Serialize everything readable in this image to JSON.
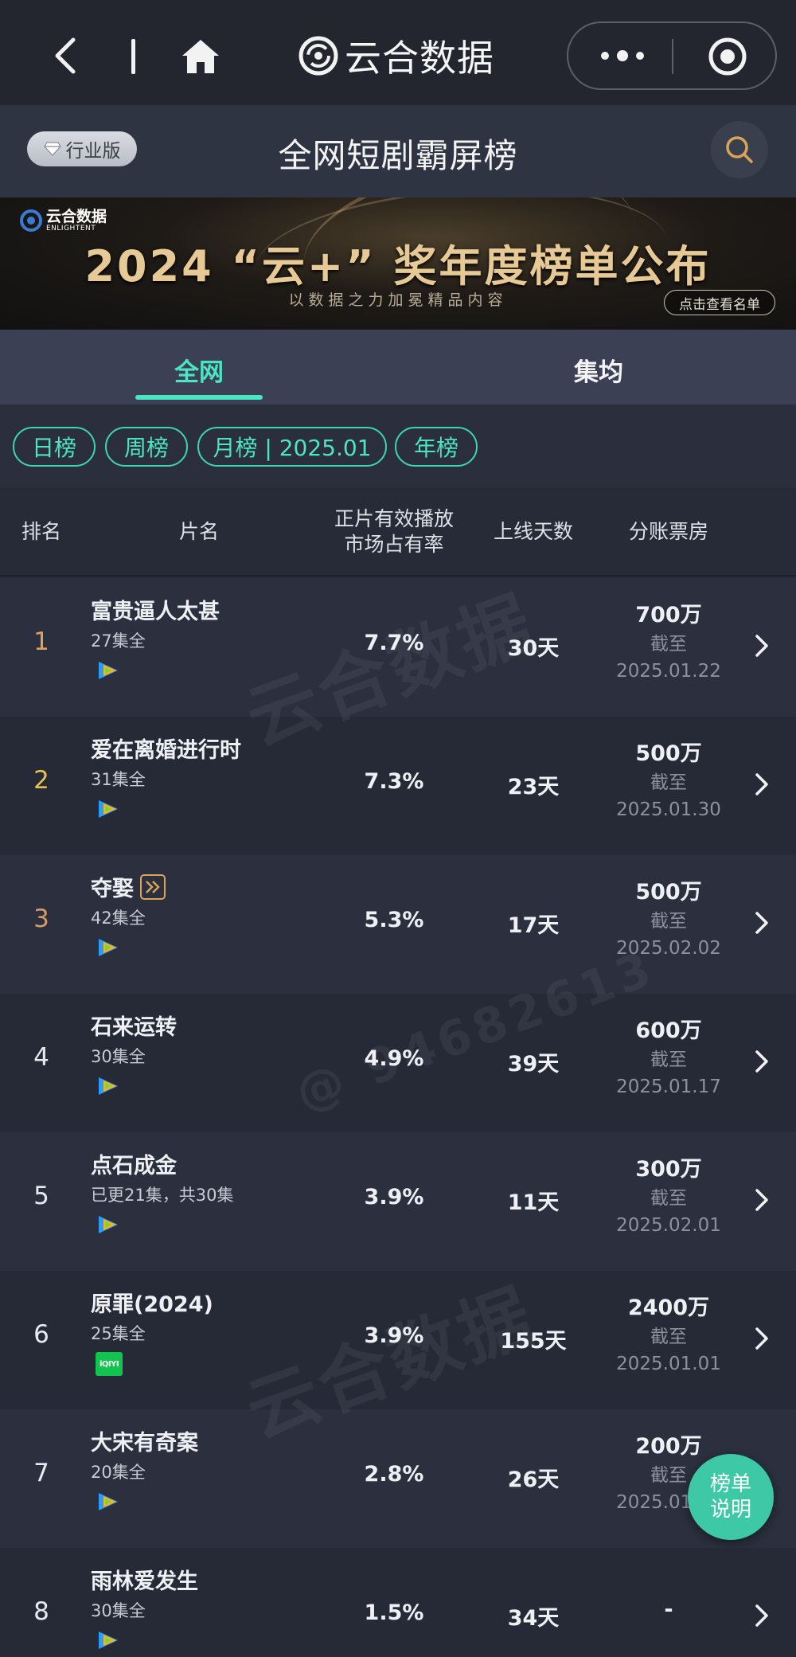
{
  "nav": {
    "brand": "云合数据"
  },
  "header": {
    "badge": "行业版",
    "title": "全网短剧霸屏榜"
  },
  "banner": {
    "logo_cn": "云合数据",
    "logo_en": "ENLIGHTENT",
    "title": "2024 “云+” 奖年度榜单公布",
    "subtitle": "以数据之力加冕精品内容",
    "button": "点击查看名单"
  },
  "tabs": [
    {
      "label": "全网",
      "active": true
    },
    {
      "label": "集均",
      "active": false
    }
  ],
  "periods": [
    {
      "label": "日榜",
      "active": false
    },
    {
      "label": "周榜",
      "active": false
    },
    {
      "label": "月榜 | 2025.01",
      "active": true
    },
    {
      "label": "年榜",
      "active": false
    }
  ],
  "table": {
    "headers": {
      "rank": "排名",
      "name": "片名",
      "share_line1": "正片有效播放",
      "share_line2": "市场占有率",
      "days": "上线天数",
      "box": "分账票房"
    },
    "rows": [
      {
        "rank": "1",
        "name": "富贵逼人太甚",
        "episodes": "27集全",
        "platform": "tencent-video-icon",
        "share": "7.7%",
        "days": "30天",
        "box": "700万",
        "asof_label": "截至",
        "asof_date": "2025.01.22"
      },
      {
        "rank": "2",
        "name": "爱在离婚进行时",
        "episodes": "31集全",
        "platform": "tencent-video-icon",
        "share": "7.3%",
        "days": "23天",
        "box": "500万",
        "asof_label": "截至",
        "asof_date": "2025.01.30"
      },
      {
        "rank": "3",
        "name": "夺娶",
        "episodes": "42集全",
        "platform": "tencent-video-icon",
        "share": "5.3%",
        "days": "17天",
        "box": "500万",
        "asof_label": "截至",
        "asof_date": "2025.02.02"
      },
      {
        "rank": "4",
        "name": "石来运转",
        "episodes": "30集全",
        "platform": "tencent-video-icon",
        "share": "4.9%",
        "days": "39天",
        "box": "600万",
        "asof_label": "截至",
        "asof_date": "2025.01.17"
      },
      {
        "rank": "5",
        "name": "点石成金",
        "episodes": "已更21集，共30集",
        "platform": "tencent-video-icon",
        "share": "3.9%",
        "days": "11天",
        "box": "300万",
        "asof_label": "截至",
        "asof_date": "2025.02.01"
      },
      {
        "rank": "6",
        "name": "原罪(2024)",
        "episodes": "25集全",
        "platform": "iqiyi-icon",
        "platform_text": "iQIYI",
        "share": "3.9%",
        "days": "155天",
        "box": "2400万",
        "asof_label": "截至",
        "asof_date": "2025.01.01"
      },
      {
        "rank": "7",
        "name": "大宋有奇案",
        "episodes": "20集全",
        "platform": "tencent-video-icon",
        "share": "2.8%",
        "days": "26天",
        "box": "200万",
        "asof_label": "截至",
        "asof_date": "2025.01.20"
      },
      {
        "rank": "8",
        "name": "雨林爱发生",
        "episodes": "30集全",
        "platform": "tencent-video-icon",
        "share": "1.5%",
        "days": "34天",
        "box": "-",
        "asof_label": "",
        "asof_date": ""
      }
    ]
  },
  "watermarks": {
    "brand_cn": "云合数据",
    "brand_en": "ENLIGHTENT",
    "user_id": "@ 94682613"
  },
  "fab": {
    "line1": "榜单",
    "line2": "说明"
  },
  "colors": {
    "accent": "#4ce5c1",
    "rank1": "#e0a25a",
    "rank2": "#e8bf55",
    "rank3": "#d59a6c"
  }
}
